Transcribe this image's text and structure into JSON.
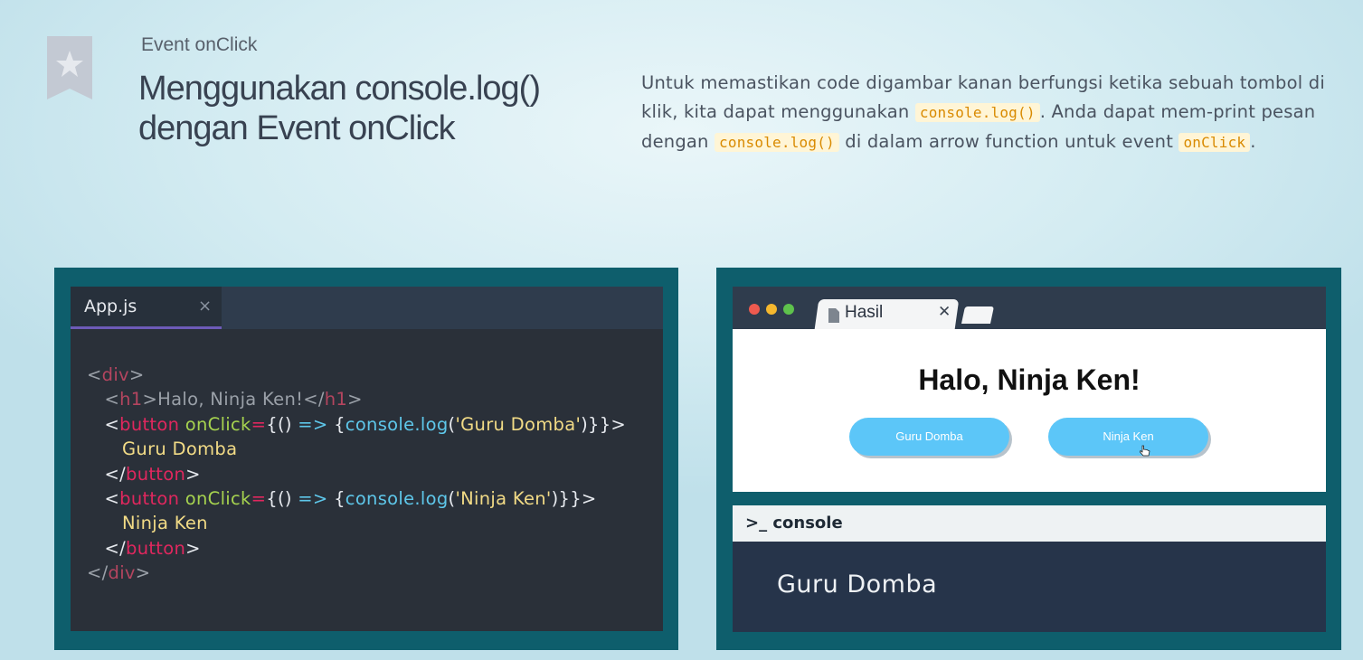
{
  "header": {
    "kicker": "Event onClick",
    "title_line1": "Menggunakan console.log()",
    "title_line2": "dengan Event onClick"
  },
  "description": {
    "part1": "Untuk memastikan code digambar kanan berfungsi ketika sebuah tombol di klik, kita dapat menggunakan ",
    "code1": "console.log()",
    "part2": ". Anda dapat mem-print pesan dengan ",
    "code2": "console.log()",
    "part3": " di dalam arrow function untuk event ",
    "code3": "onClick",
    "part4": "."
  },
  "editor": {
    "tab_label": "App.js",
    "tab_close": "×"
  },
  "browser": {
    "tab_label": "Hasil",
    "tab_close": "✕",
    "page_heading": "Halo, Ninja Ken!",
    "button1": "Guru Domba",
    "button2": "Ninja Ken",
    "console_label": ">_ console",
    "console_output": "Guru Domba",
    "dot_colors": [
      "#ee5a4f",
      "#f5b82e",
      "#5ec24c"
    ]
  },
  "colors": {
    "panel_frame": "#0e5e6c",
    "editor_bg": "#2a3039",
    "tab_underline": "#6d5bb8",
    "button_blue": "#5cc6f8",
    "code_highlight": "#d98a00"
  },
  "icons": {
    "bookmark": "bookmark-star-icon",
    "file": "file-icon",
    "cursor": "hand-cursor-icon"
  }
}
